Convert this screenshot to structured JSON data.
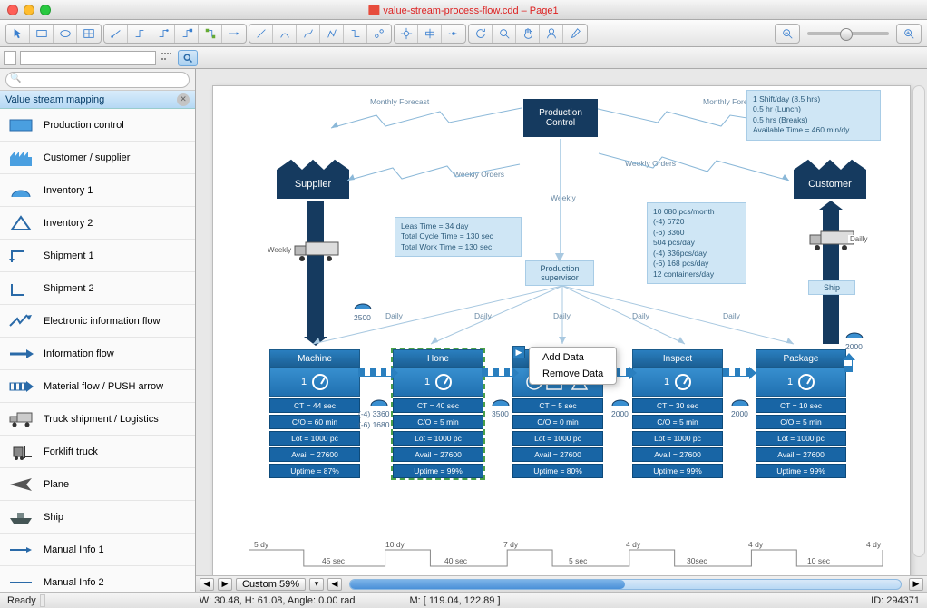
{
  "titlebar": {
    "title": "value-stream-process-flow.cdd – Page1"
  },
  "sidebar": {
    "header": "Value stream mapping",
    "items": [
      {
        "label": "Production control",
        "icon": "rect-blue"
      },
      {
        "label": "Customer / supplier",
        "icon": "factory"
      },
      {
        "label": "Inventory 1",
        "icon": "inv1"
      },
      {
        "label": "Inventory 2",
        "icon": "inv2"
      },
      {
        "label": "Shipment 1",
        "icon": "ship1"
      },
      {
        "label": "Shipment 2",
        "icon": "ship2"
      },
      {
        "label": "Electronic information flow",
        "icon": "zig"
      },
      {
        "label": "Information flow",
        "icon": "arrow"
      },
      {
        "label": "Material flow / PUSH arrow",
        "icon": "push"
      },
      {
        "label": "Truck shipment / Logistics",
        "icon": "truck"
      },
      {
        "label": "Forklift truck",
        "icon": "forklift"
      },
      {
        "label": "Plane",
        "icon": "plane"
      },
      {
        "label": "Ship",
        "icon": "ship"
      },
      {
        "label": "Manual Info 1",
        "icon": "line1"
      },
      {
        "label": "Manual Info 2",
        "icon": "line2"
      }
    ]
  },
  "context_menu": {
    "items": [
      "Add Data",
      "Remove Data"
    ]
  },
  "hscroll": {
    "zoom": "Custom 59%"
  },
  "status": {
    "ready": "Ready",
    "dims": "W: 30.48,  H: 61.08,  Angle: 0.00 rad",
    "mouse": "M: [ 119.04, 122.89 ]",
    "id": "ID: 294371"
  },
  "diagram": {
    "prod_control": "Production Control",
    "supplier": "Supplier",
    "customer": "Customer",
    "monthly": "Monthly Forecast",
    "weekly_orders": "Weekly Orders",
    "weekly": "Weekly",
    "daily": "Daily",
    "prod_sup": "Production supervisor",
    "ship": "Ship",
    "truck_weekly": "Weekly",
    "truck_daily": "Dailly",
    "note_shift": "1 Shift/day (8.5 hrs)\n0.5 hr (Lunch)\n0.5 hrs (Breaks)\nAvailable Time = 460 min/dy",
    "note_lean": "Leas Time = 34 day\nTotal Cycle Time = 130 sec\nTotal Work Time = 130 sec",
    "note_pcs": "10 080 pcs/month\n(-4) 6720\n(-6) 3360\n504 pcs/day\n(-4) 336pcs/day\n(-6) 168 pcs/day\n12 containers/day",
    "inv": {
      "i0": "2500",
      "i1a": "(-4) 3360",
      "i1b": "(-6) 1680",
      "i2": "3500",
      "i3": "2000",
      "i4": "2000",
      "i5": "2000"
    },
    "processes": [
      {
        "name": "Machine",
        "num": "1",
        "rows": [
          "CT = 44 sec",
          "C/O = 60 min",
          "Lot = 1000 pc",
          "Avail = 27600",
          "Uptime = 87%"
        ]
      },
      {
        "name": "Hone",
        "num": "1",
        "rows": [
          "CT = 40 sec",
          "C/O = 5 min",
          "Lot = 1000 pc",
          "Avail = 27600",
          "Uptime = 99%"
        ]
      },
      {
        "name": "",
        "num": "",
        "rows": [
          "CT = 5 sec",
          "C/O = 0 min",
          "Lot = 1000 pc",
          "Avail = 27600",
          "Uptime = 80%"
        ]
      },
      {
        "name": "Inspect",
        "num": "1",
        "rows": [
          "CT = 30 sec",
          "C/O = 5 min",
          "Lot = 1000 pc",
          "Avail = 27600",
          "Uptime = 99%"
        ]
      },
      {
        "name": "Package",
        "num": "1",
        "rows": [
          "CT = 10 sec",
          "C/O = 5 min",
          "Lot = 1000 pc",
          "Avail = 27600",
          "Uptime = 99%"
        ]
      }
    ],
    "timeline": {
      "top": [
        "5 dy",
        "10 dy",
        "7 dy",
        "4 dy",
        "4 dy",
        "4 dy"
      ],
      "bot": [
        "45 sec",
        "40 sec",
        "5 sec",
        "30sec",
        "10 sec"
      ]
    }
  }
}
